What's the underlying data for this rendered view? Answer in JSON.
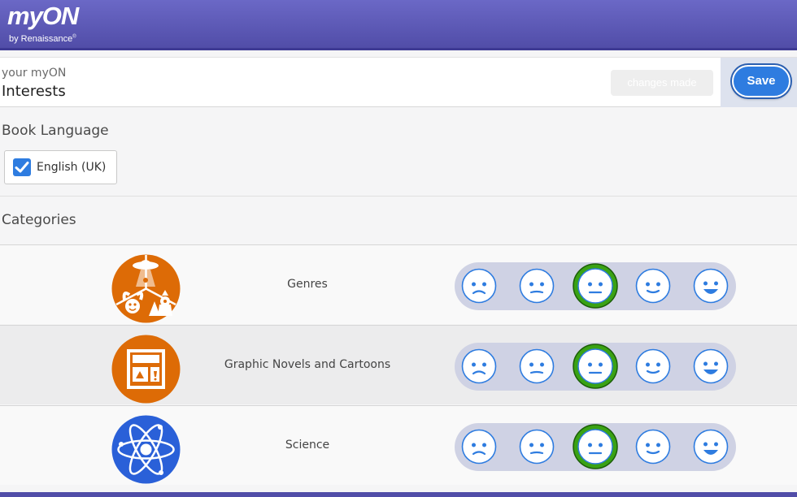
{
  "header": {
    "logo": "myON",
    "logo_sub": "by Renaissance",
    "logo_sub_mark": "®"
  },
  "page": {
    "subtitle": "your myON",
    "title": "Interests"
  },
  "status": {
    "changes_label": "changes made"
  },
  "toolbar": {
    "save_label": "Save"
  },
  "language": {
    "section_title": "Book Language",
    "option_label": "English (UK)",
    "checked": true
  },
  "categories": {
    "section_title": "Categories",
    "items": [
      {
        "label": "Genres",
        "icon": "genres-icon",
        "icon_color": "#dd6b06",
        "rating": 3
      },
      {
        "label": "Graphic Novels and Cartoons",
        "icon": "comic-panel-icon",
        "icon_color": "#dd6b06",
        "rating": 3
      },
      {
        "label": "Science",
        "icon": "atom-icon",
        "icon_color": "#2a60d8",
        "rating": 3
      }
    ]
  },
  "rating_scale": [
    "very-sad-face-icon",
    "sad-face-icon",
    "neutral-face-icon",
    "happy-face-icon",
    "very-happy-face-icon"
  ],
  "colors": {
    "brand": "#5b57b8",
    "accent": "#2e7ce0",
    "selected_ring": "#3aa214",
    "face_outline": "#2e7ce0"
  }
}
